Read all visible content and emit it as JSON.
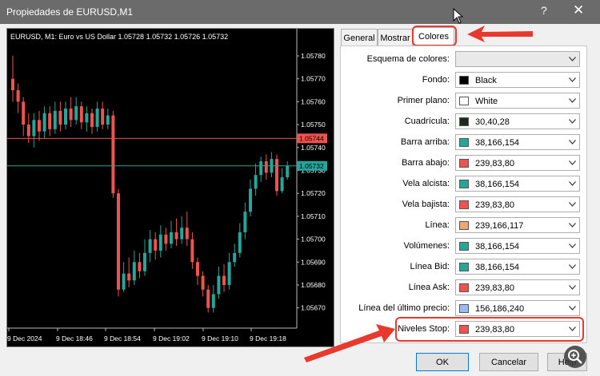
{
  "window": {
    "title": "Propiedades de EURUSD,M1",
    "help_label": "?",
    "close_label": "✕"
  },
  "chart": {
    "header": "EURUSD, M1:  Euro vs US Dollar  1.05728 1.05732 1.05726 1.05732",
    "price_ticks": [
      "1.05780",
      "1.05770",
      "1.05760",
      "1.05750",
      "1.05740",
      "1.05730",
      "1.05720",
      "1.05710",
      "1.05700",
      "1.05690",
      "1.05680",
      "1.05670"
    ],
    "time_ticks": [
      "9 Dec 2024",
      "9 Dec 18:46",
      "9 Dec 18:54",
      "9 Dec 19:02",
      "9 Dec 19:10",
      "9 Dec 19:18"
    ],
    "bid_level": "1.05744",
    "current_price": "1.05732"
  },
  "tabs": [
    {
      "label": "General"
    },
    {
      "label": "Mostrar"
    },
    {
      "label": "Colores",
      "active": true
    }
  ],
  "properties": [
    {
      "label": "Esquema de colores:",
      "value": "",
      "color": ""
    },
    {
      "label": "Fondo:",
      "value": "Black",
      "color": "#000000"
    },
    {
      "label": "Primer plano:",
      "value": "White",
      "color": "#ffffff"
    },
    {
      "label": "Cuadrícula:",
      "value": "30,40,28",
      "color": "#1e281c"
    },
    {
      "label": "Barra arriba:",
      "value": "38,166,154",
      "color": "#26a69a"
    },
    {
      "label": "Barra abajo:",
      "value": "239,83,80",
      "color": "#ef5350"
    },
    {
      "label": "Vela alcista:",
      "value": "38,166,154",
      "color": "#26a69a"
    },
    {
      "label": "Vela bajista:",
      "value": "239,83,80",
      "color": "#ef5350"
    },
    {
      "label": "Línea:",
      "value": "239,166,117",
      "color": "#efa675"
    },
    {
      "label": "Volúmenes:",
      "value": "38,166,154",
      "color": "#26a69a"
    },
    {
      "label": "Línea Bid:",
      "value": "38,166,154",
      "color": "#26a69a"
    },
    {
      "label": "Línea Ask:",
      "value": "239,83,80",
      "color": "#ef5350"
    },
    {
      "label": "Línea del último precio:",
      "value": "156,186,240",
      "color": "#9cbaf0"
    },
    {
      "label": "Niveles Stop:",
      "value": "239,83,80",
      "color": "#ef5350"
    }
  ],
  "buttons": {
    "ok": "OK",
    "cancel": "Cancelar",
    "help": "Help"
  },
  "colors": {
    "annotation": "#e8392e",
    "bull": "#26a69a",
    "bear": "#ef5350"
  }
}
